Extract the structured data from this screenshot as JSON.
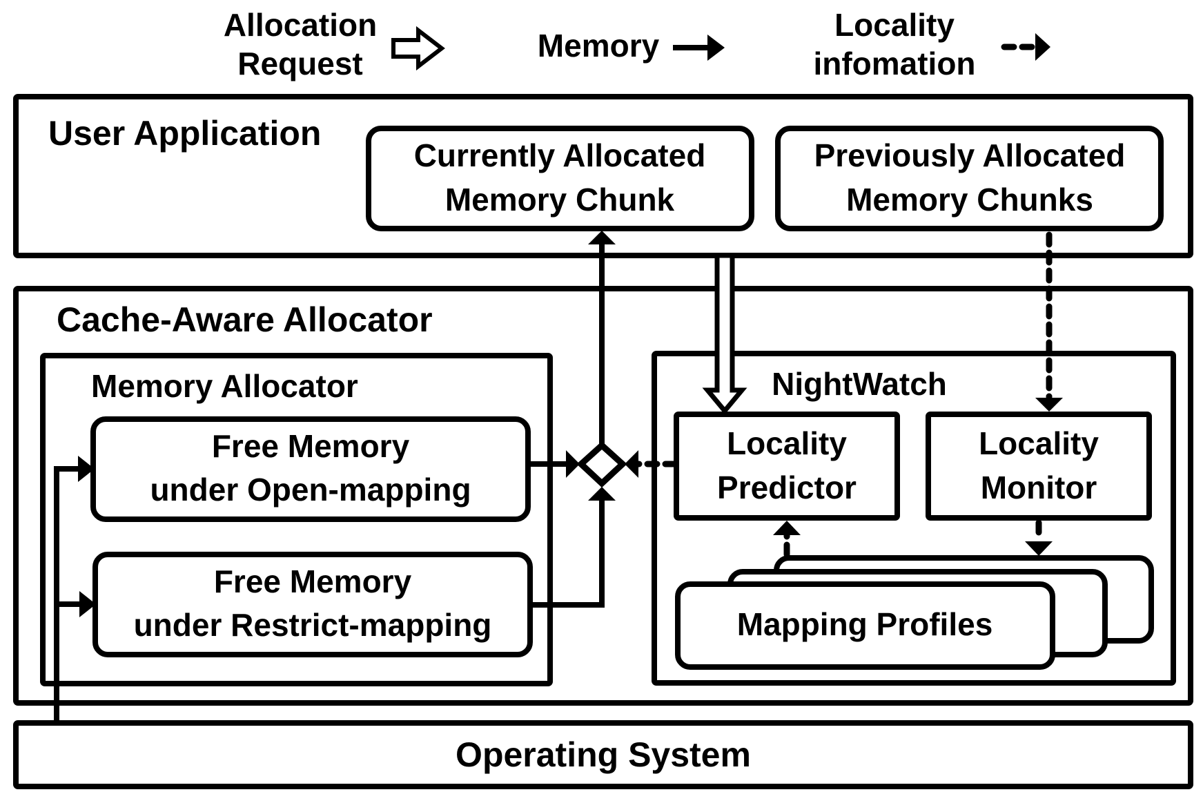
{
  "legend": {
    "allocation_request_line1": "Allocation",
    "allocation_request_line2": "Request",
    "memory": "Memory",
    "locality_line1": "Locality",
    "locality_line2": "infomation"
  },
  "layers": {
    "user_application": "User Application",
    "cache_aware_allocator": "Cache-Aware Allocator",
    "operating_system": "Operating System"
  },
  "user_app": {
    "current_chunk_line1": "Currently Allocated",
    "current_chunk_line2": "Memory Chunk",
    "previous_chunks_line1": "Previously Allocated",
    "previous_chunks_line2": "Memory Chunks"
  },
  "memory_allocator": {
    "title": "Memory Allocator",
    "open_line1": "Free Memory",
    "open_line2": "under Open-mapping",
    "restrict_line1": "Free Memory",
    "restrict_line2": "under Restrict-mapping"
  },
  "nightwatch": {
    "title": "NightWatch",
    "predictor_line1": "Locality",
    "predictor_line2": "Predictor",
    "monitor_line1": "Locality",
    "monitor_line2": "Monitor",
    "profiles": "Mapping Profiles"
  }
}
